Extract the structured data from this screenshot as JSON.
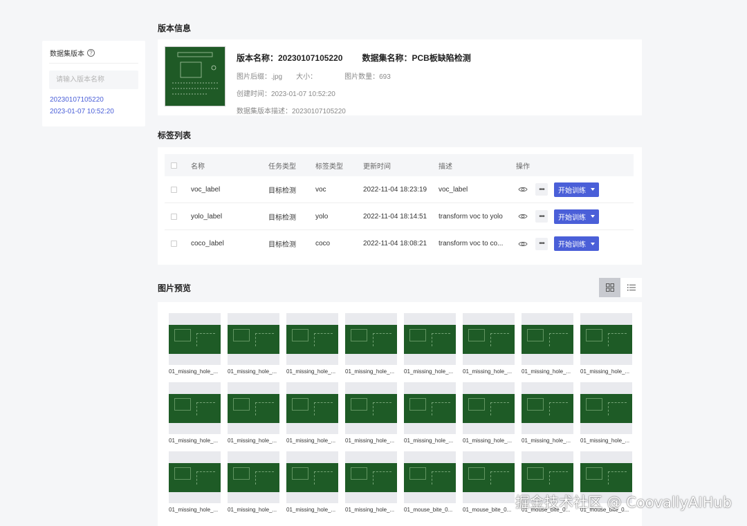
{
  "sidebar": {
    "title": "数据集版本",
    "search_placeholder": "请输入版本名称",
    "versions": [
      {
        "name": "20230107105220",
        "time": "2023-01-07 10:52:20"
      }
    ]
  },
  "version_info": {
    "section_title": "版本信息",
    "name_label": "版本名称：20230107105220",
    "dataset_label": "数据集名称：PCB板缺陷检测",
    "suffix": "图片后缀：.jpg",
    "size": "大小：",
    "count": "图片数量：693",
    "created": "创建时间：2023-01-07 10:52:20",
    "description": "数据集版本描述：20230107105220"
  },
  "labels": {
    "section_title": "标签列表",
    "columns": [
      "名称",
      "任务类型",
      "标签类型",
      "更新时间",
      "描述",
      "操作"
    ],
    "train_label": "开始训练",
    "rows": [
      {
        "name": "voc_label",
        "task": "目标检测",
        "type": "voc",
        "updated": "2022-11-04 18:23:19",
        "desc": "voc_label"
      },
      {
        "name": "yolo_label",
        "task": "目标检测",
        "type": "yolo",
        "updated": "2022-11-04 18:14:51",
        "desc": "transform voc to yolo"
      },
      {
        "name": "coco_label",
        "task": "目标检测",
        "type": "coco",
        "updated": "2022-11-04 18:08:21",
        "desc": "transform voc to co..."
      }
    ]
  },
  "preview": {
    "section_title": "图片预览",
    "view_modes": [
      "grid-icon",
      "list-icon"
    ],
    "active_view": "grid",
    "images": [
      "01_missing_hole_...",
      "01_missing_hole_...",
      "01_missing_hole_...",
      "01_missing_hole_...",
      "01_missing_hole_...",
      "01_missing_hole_...",
      "01_missing_hole_...",
      "01_missing_hole_...",
      "01_missing_hole_...",
      "01_missing_hole_...",
      "01_missing_hole_...",
      "01_missing_hole_...",
      "01_missing_hole_...",
      "01_missing_hole_...",
      "01_missing_hole_...",
      "01_missing_hole_...",
      "01_missing_hole_...",
      "01_missing_hole_...",
      "01_missing_hole_...",
      "01_missing_hole_...",
      "01_mouse_bite_0...",
      "01_mouse_bite_0...",
      "01_mouse_bite_0...",
      "01_mouse_bite_0..."
    ]
  },
  "watermark": "掘金技术社区 @ CoovallyAIHub",
  "colors": {
    "accent": "#4a5fd8",
    "pcb_green": "#1e5b26",
    "background": "#f5f6f8"
  }
}
